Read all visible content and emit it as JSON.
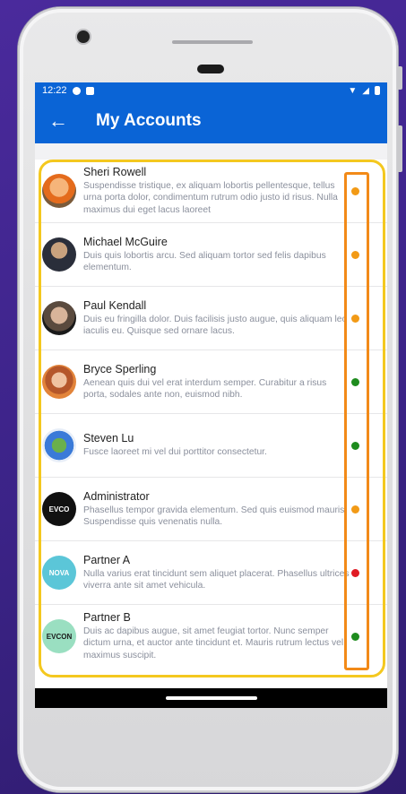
{
  "status_bar": {
    "time": "12:22"
  },
  "app_bar": {
    "back_icon": "arrow-left-icon",
    "title": "My Accounts"
  },
  "accounts": [
    {
      "name": "Sheri Rowell",
      "description": "Suspendisse tristique, ex aliquam lobortis pellentesque, tellus urna porta dolor, condimentum rutrum odio justo id risus. Nulla maximus dui eget lacus laoreet",
      "status_color": "#f29a16"
    },
    {
      "name": "Michael McGuire",
      "description": "Duis quis lobortis arcu. Sed aliquam tortor sed felis dapibus elementum.",
      "status_color": "#f29a16"
    },
    {
      "name": "Paul Kendall",
      "description": "Duis eu fringilla dolor. Duis facilisis justo augue, quis aliquam leo iaculis eu. Quisque sed ornare lacus.",
      "status_color": "#f29a16"
    },
    {
      "name": "Bryce Sperling",
      "description": "Aenean quis dui vel erat interdum semper. Curabitur a risus porta, sodales ante non, euismod nibh.",
      "status_color": "#1e8c1e"
    },
    {
      "name": "Steven Lu",
      "description": "Fusce laoreet mi vel dui porttitor consectetur.",
      "status_color": "#1e8c1e"
    },
    {
      "name": "Administrator",
      "description": "Phasellus tempor gravida elementum. Sed quis euismod mauris. Suspendisse quis venenatis nulla.",
      "status_color": "#f29a16",
      "avatar_text": "EVCO"
    },
    {
      "name": "Partner A",
      "description": "Nulla varius erat tincidunt sem aliquet placerat. Phasellus ultrices viverra ante sit amet vehicula.",
      "status_color": "#e01b24",
      "avatar_text": "NOVA"
    },
    {
      "name": "Partner B",
      "description": "Duis ac dapibus augue, sit amet feugiat tortor. Nunc semper dictum urna, et auctor ante tincidunt et. Mauris rutrum lectus vel maximus suscipit.",
      "status_color": "#1e8c1e",
      "avatar_text": "EVCON"
    }
  ]
}
